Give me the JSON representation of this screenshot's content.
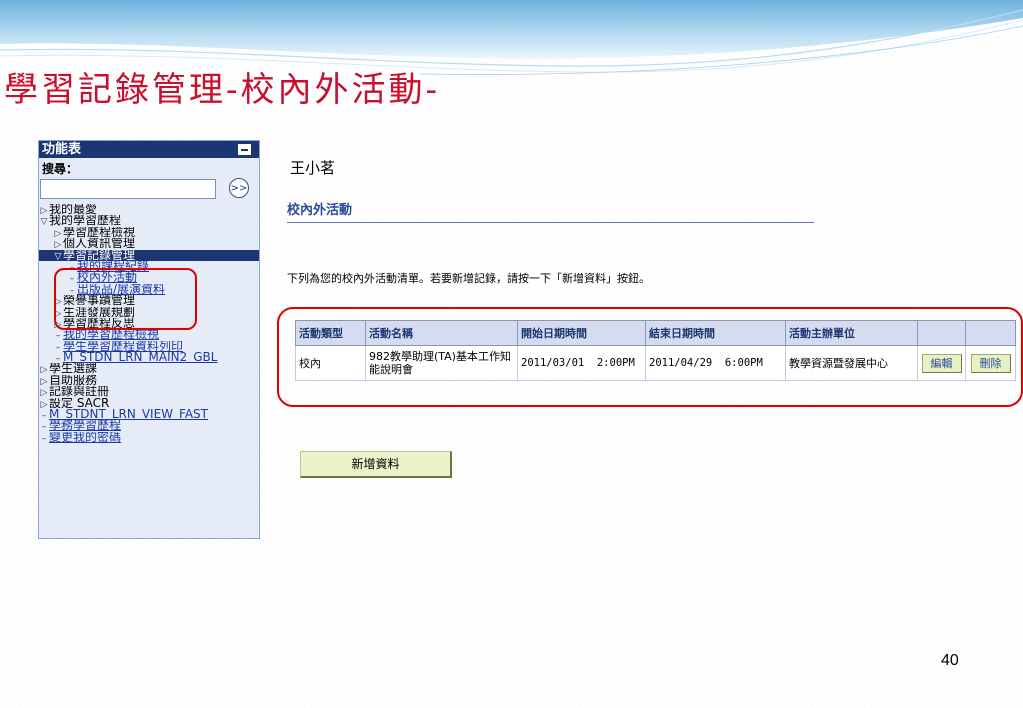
{
  "slide": {
    "title": "學習記錄管理-校內外活動-",
    "page_number": "40"
  },
  "sidebar": {
    "header": "功能表",
    "search_label": "搜尋：",
    "search_value": "",
    "items": [
      {
        "label": "我的最愛",
        "marker": "▷",
        "level": 0,
        "link": false,
        "active": false
      },
      {
        "label": "我的學習歷程",
        "marker": "▽",
        "level": 0,
        "link": false,
        "active": false
      },
      {
        "label": "學習歷程檢視",
        "marker": "▷",
        "level": 1,
        "link": false,
        "active": false
      },
      {
        "label": "個人資訊管理",
        "marker": "▷",
        "level": 1,
        "link": false,
        "active": false
      },
      {
        "label": "學習記錄管理",
        "marker": "▽",
        "level": 1,
        "link": false,
        "active": true
      },
      {
        "label": "我的課程紀錄",
        "marker": "–",
        "level": 2,
        "link": true,
        "active": false
      },
      {
        "label": "校內外活動",
        "marker": "–",
        "level": 2,
        "link": true,
        "active": false
      },
      {
        "label": "出版品/展演資料",
        "marker": "–",
        "level": 2,
        "link": true,
        "active": false
      },
      {
        "label": "榮譽事蹟管理",
        "marker": "▷",
        "level": 1,
        "link": false,
        "active": false
      },
      {
        "label": "生涯發展規劃",
        "marker": "▷",
        "level": 1,
        "link": false,
        "active": false
      },
      {
        "label": "學習歷程反思",
        "marker": "▷",
        "level": 1,
        "link": false,
        "active": false
      },
      {
        "label": "我的學習歷程檢視",
        "marker": "–",
        "level": 1,
        "link": true,
        "active": false
      },
      {
        "label": "學生學習歷程資料列印",
        "marker": "–",
        "level": 1,
        "link": true,
        "active": false
      },
      {
        "label": "M_STDN_LRN_MAIN2_GBL",
        "marker": "–",
        "level": 1,
        "link": true,
        "active": false
      },
      {
        "label": "學生選課",
        "marker": "▷",
        "level": 0,
        "link": false,
        "active": false
      },
      {
        "label": "自助服務",
        "marker": "▷",
        "level": 0,
        "link": false,
        "active": false
      },
      {
        "label": "記錄與註冊",
        "marker": "▷",
        "level": 0,
        "link": false,
        "active": false
      },
      {
        "label": "設定 SACR",
        "marker": "▷",
        "level": 0,
        "link": false,
        "active": false
      },
      {
        "label": "M_STDNT_LRN_VIEW_FAST",
        "marker": "–",
        "level": 0,
        "link": true,
        "active": false
      },
      {
        "label": "學務學習歷程",
        "marker": "–",
        "level": 0,
        "link": true,
        "active": false
      },
      {
        "label": "變更我的密碼",
        "marker": "–",
        "level": 0,
        "link": true,
        "active": false
      }
    ]
  },
  "main": {
    "student_name": "王小茗",
    "section_title": "校內外活動",
    "instruction": "下列為您的校內外活動清單。若要新增記錄，請按一下「新增資料」按鈕。",
    "table": {
      "headers": [
        "活動類型",
        "活動名稱",
        "開始日期時間",
        "結束日期時間",
        "活動主辦單位",
        "",
        ""
      ],
      "rows": [
        {
          "type": "校內",
          "name": "982教學助理(TA)基本工作知能說明會",
          "start": "2011/03/01  2:00PM",
          "end": "2011/04/29  6:00PM",
          "organizer": "教學資源暨發展中心",
          "edit_label": "編輯",
          "delete_label": "刪除"
        }
      ]
    },
    "add_button_label": "新增資料"
  },
  "colors": {
    "title_red": "#c8102e",
    "menu_header": "#1c3673",
    "link_blue": "#1a38a8",
    "highlight_red": "#e00000",
    "button_green": "#e6f2c2"
  }
}
